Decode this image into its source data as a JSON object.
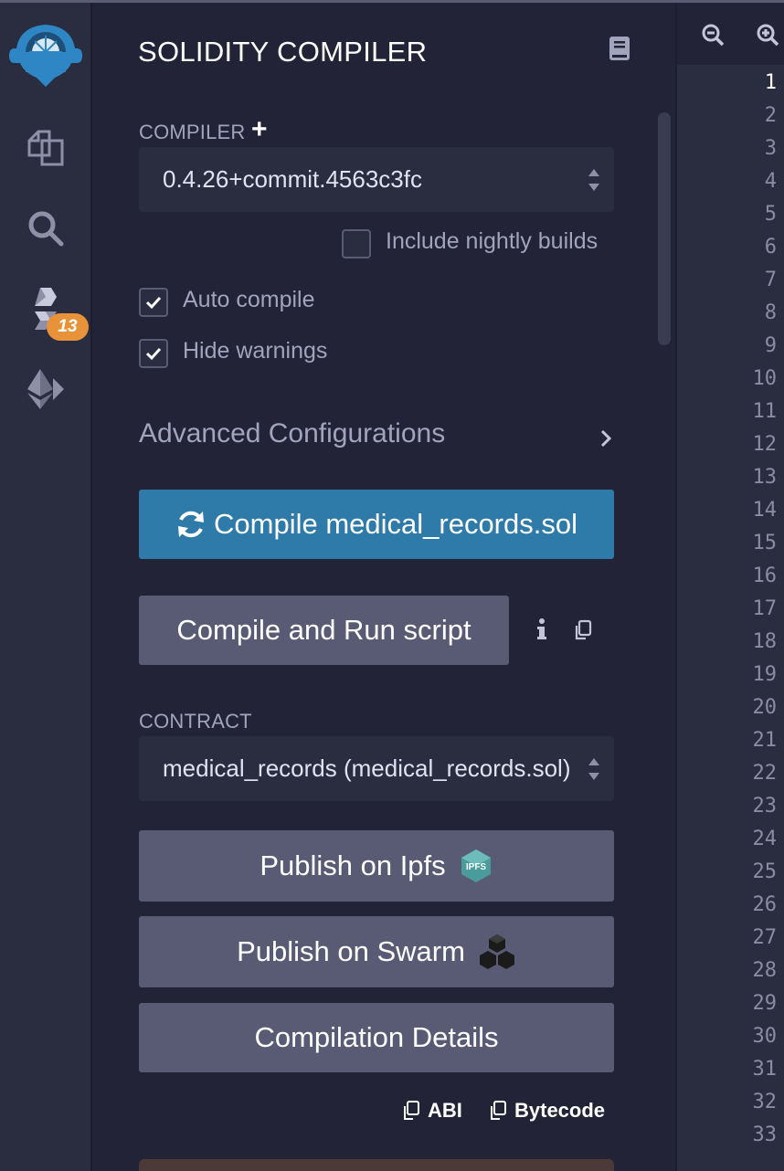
{
  "sidebar": {
    "plugin_badge": "13",
    "icons": [
      "remix-logo-icon",
      "file-explorer-icon",
      "search-icon",
      "solidity-compiler-icon",
      "deploy-run-icon"
    ]
  },
  "panel": {
    "title": "SOLIDITY COMPILER",
    "compiler_label": "COMPILER",
    "compiler_version": "0.4.26+commit.4563c3fc",
    "nightly_label": "Include nightly builds",
    "nightly_checked": false,
    "auto_compile_label": "Auto compile",
    "auto_compile_checked": true,
    "hide_warnings_label": "Hide warnings",
    "hide_warnings_checked": true,
    "advanced_label": "Advanced Configurations",
    "compile_button": "Compile medical_records.sol",
    "compile_run_button": "Compile and Run script",
    "contract_label": "CONTRACT",
    "contract_selected": "medical_records (medical_records.sol)",
    "publish_ipfs": "Publish on Ipfs",
    "ipfs_badge": "IPFS",
    "publish_swarm": "Publish on Swarm",
    "compilation_details": "Compilation Details",
    "abi_label": "ABI",
    "bytecode_label": "Bytecode"
  },
  "editor": {
    "active_line": 1,
    "line_numbers": [
      "1",
      "2",
      "3",
      "4",
      "5",
      "6",
      "7",
      "8",
      "9",
      "10",
      "11",
      "12",
      "13",
      "14",
      "15",
      "16",
      "17",
      "18",
      "19",
      "20",
      "21",
      "22",
      "23",
      "24",
      "25",
      "26",
      "27",
      "28",
      "29",
      "30",
      "31",
      "32",
      "33"
    ]
  },
  "colors": {
    "background": "#222336",
    "panel": "#2a2c3f",
    "primary": "#2e7aa8",
    "secondary_button": "#595b75",
    "badge": "#e8923a",
    "logo": "#2e87c4"
  }
}
